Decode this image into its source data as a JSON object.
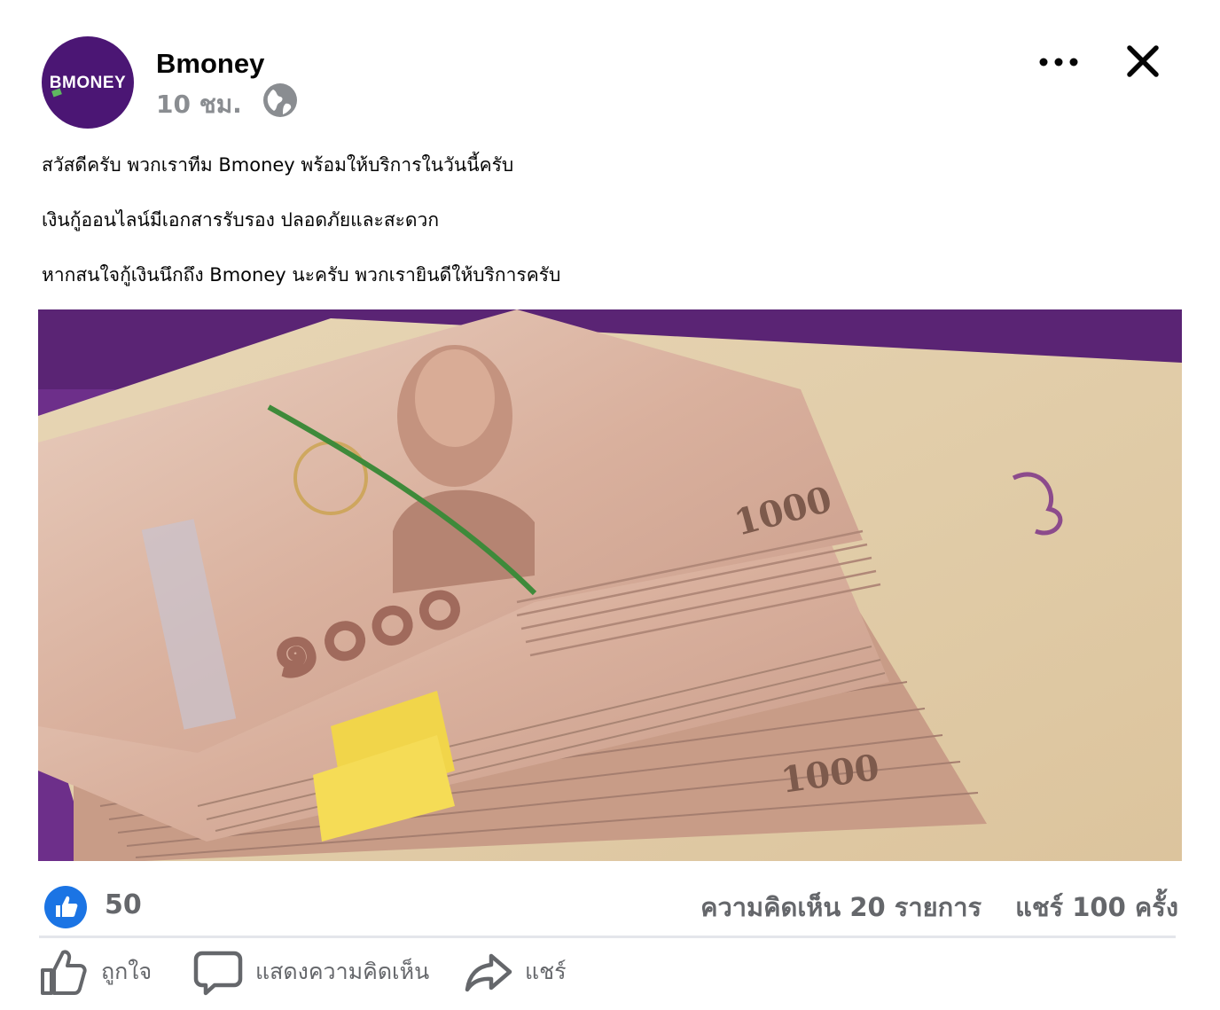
{
  "page": {
    "name": "Bmoney",
    "time": "10 ชม.",
    "avatar_text": "BMONEY"
  },
  "post": {
    "lines": [
      "สวัสดีครับ พวกเราทีม Bmoney พร้อมให้บริการในวันนี้ครับ",
      "เงินกู้ออนไลน์มีเอกสารรับรอง ปลอดภัยและสะดวก",
      "หากสนใจกู้เงินนึกถึง Bmoney นะครับ พวกเรายินดีให้บริการครับ"
    ],
    "image_texts": [
      "๑๐๐๐",
      "1000",
      "1000"
    ]
  },
  "stats": {
    "likes": "50",
    "comments": "ความคิดเห็น 20 รายการ",
    "shares": "แชร์ 100 ครั้ง"
  },
  "actions": {
    "like": "ถูกใจ",
    "comment": "แสดงความคิดเห็น",
    "share": "แชร์"
  },
  "icons": {
    "avatar": "bmoney-logo-icon",
    "privacy": "globe-icon",
    "more": "more-options-icon",
    "close": "close-icon",
    "like_badge": "thumbs-up-icon",
    "like_action": "thumbs-up-outline-icon",
    "comment_action": "comment-bubble-icon",
    "share_action": "share-arrow-icon"
  },
  "colors": {
    "brand_purple": "#4b1674",
    "like_blue": "#1b74e4",
    "secondary_text": "#65676b",
    "bill": "#d7b39f"
  }
}
